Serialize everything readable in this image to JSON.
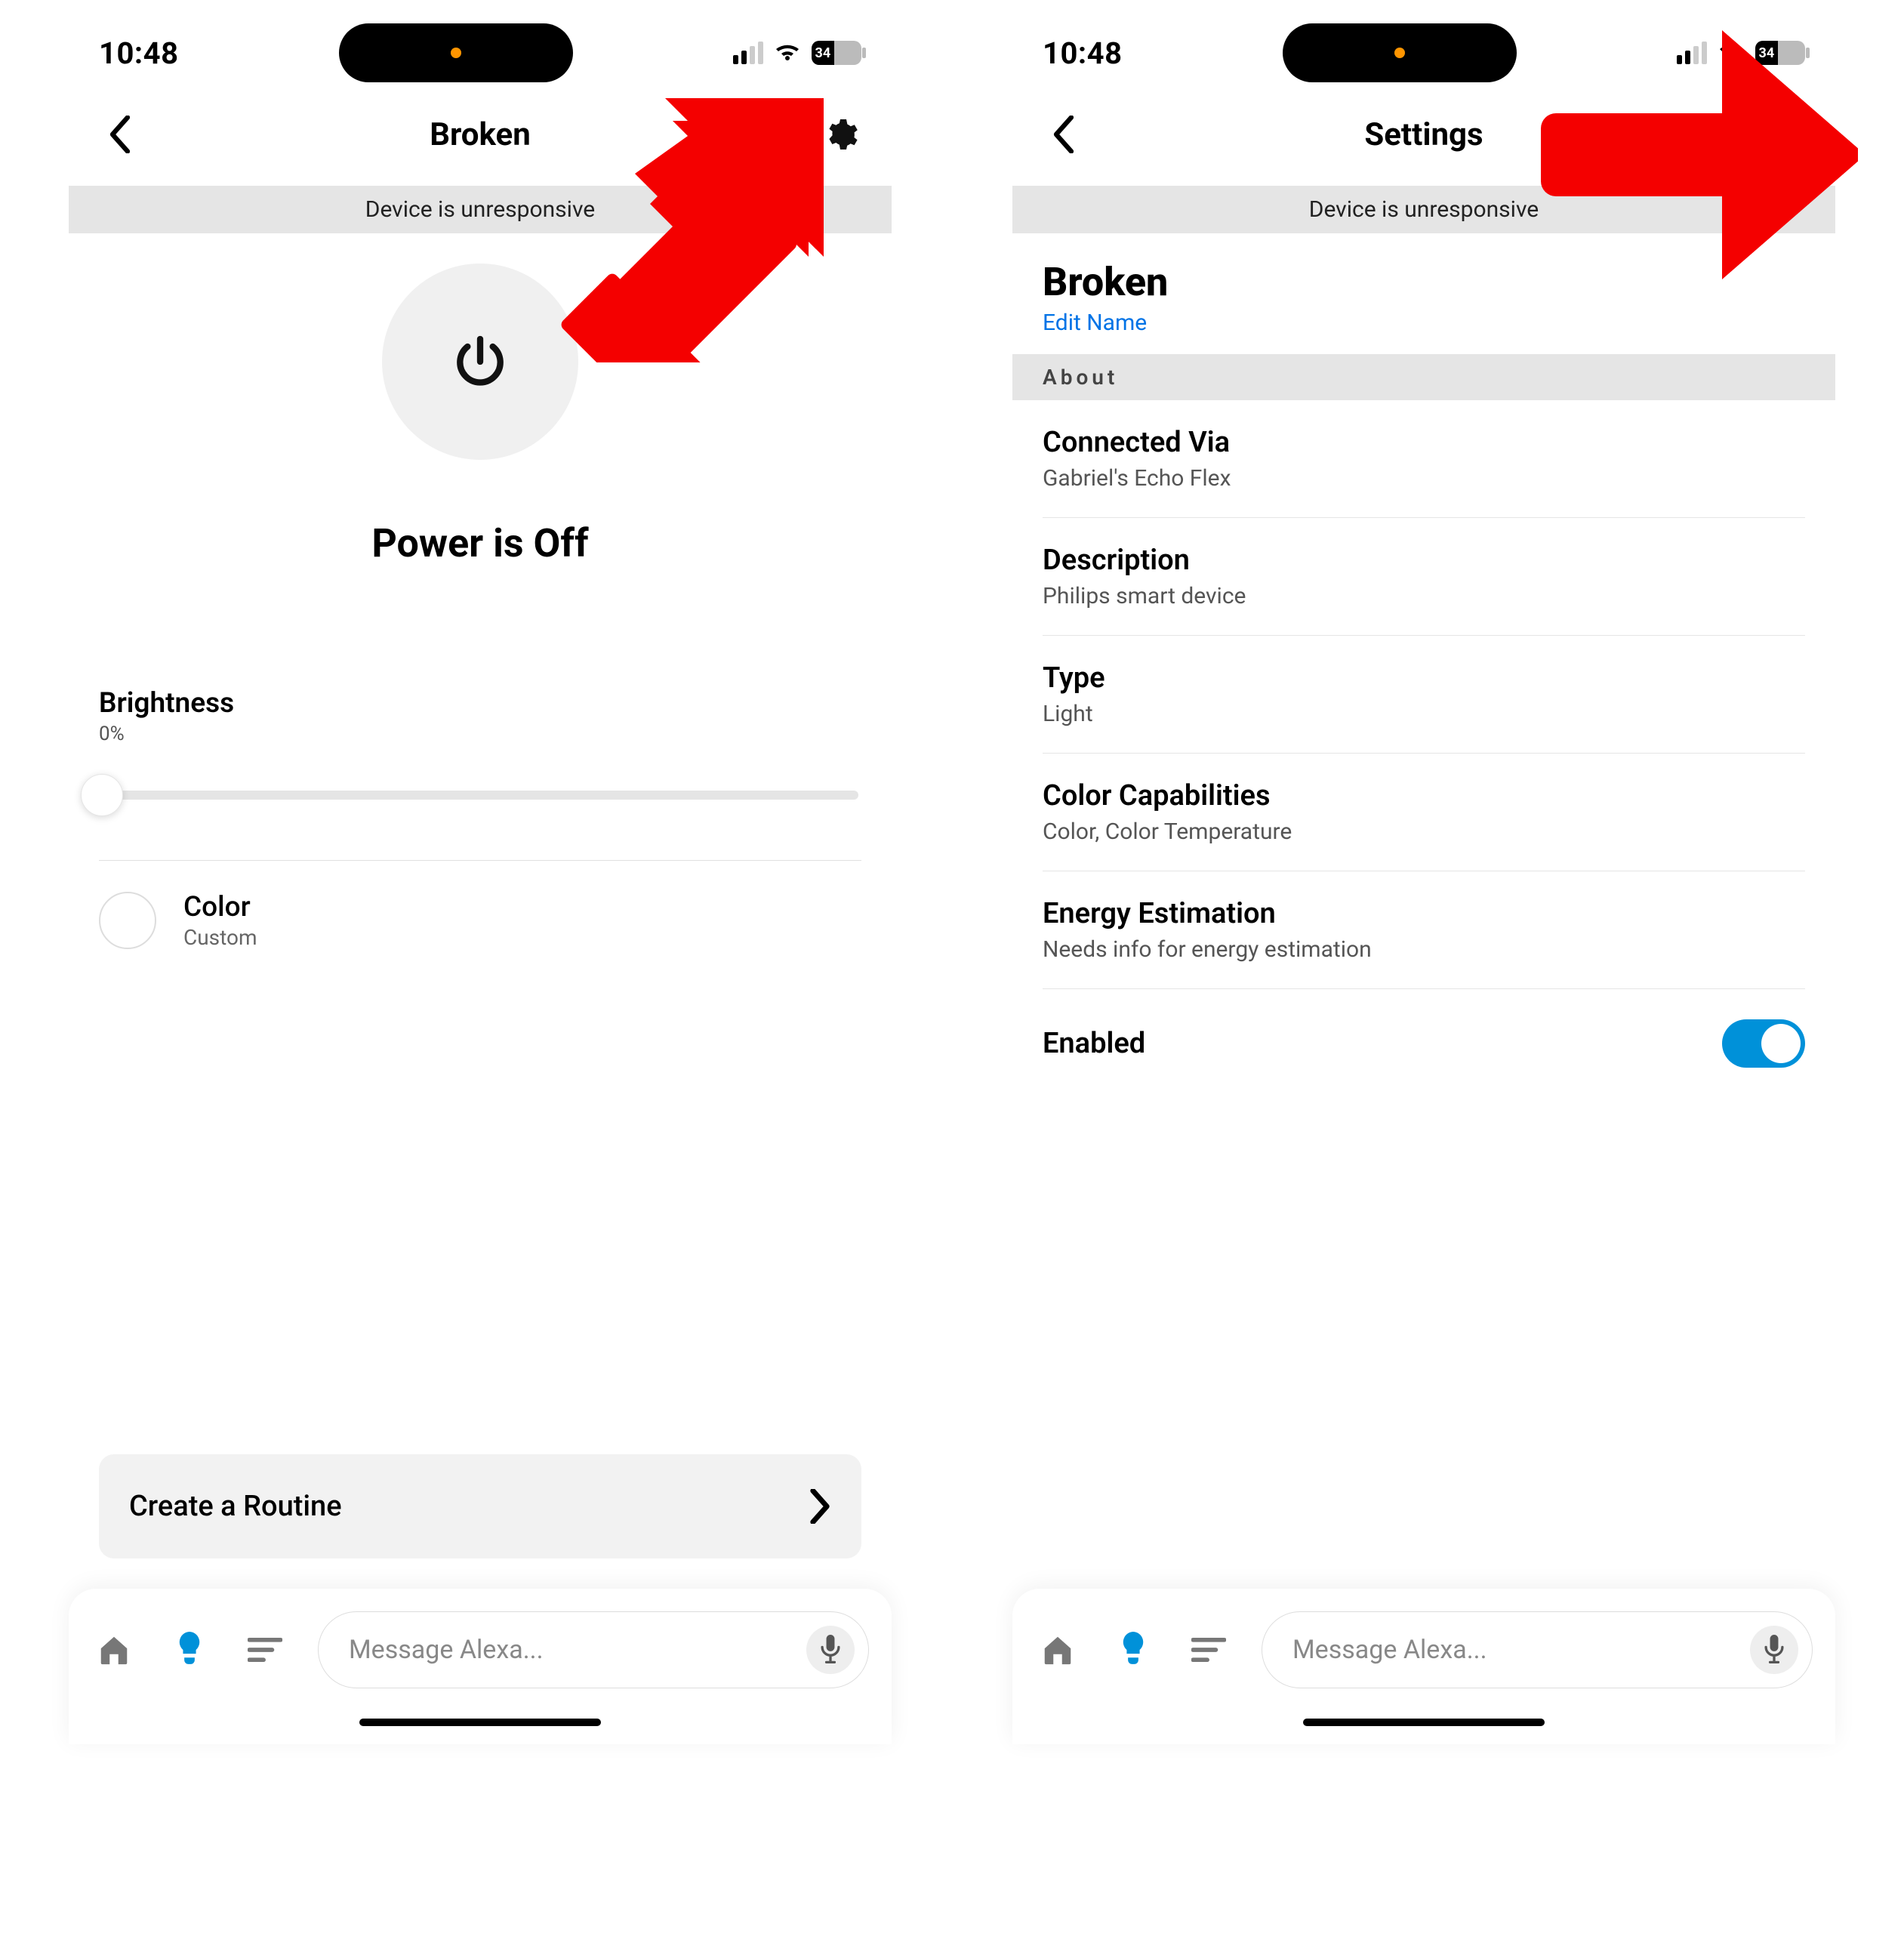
{
  "status": {
    "time": "10:48",
    "battery": "34"
  },
  "left": {
    "title": "Broken",
    "banner": "Device is unresponsive",
    "powerState": "Power is Off",
    "brightnessLabel": "Brightness",
    "brightnessValue": "0%",
    "colorLabel": "Color",
    "colorValue": "Custom",
    "routineLabel": "Create a Routine",
    "alexaPlaceholder": "Message Alexa..."
  },
  "right": {
    "title": "Settings",
    "banner": "Device is unresponsive",
    "deviceName": "Broken",
    "editName": "Edit Name",
    "sectionAbout": "About",
    "rows": {
      "connectedVia": {
        "title": "Connected Via",
        "sub": "Gabriel's Echo Flex"
      },
      "description": {
        "title": "Description",
        "sub": "Philips smart device"
      },
      "type": {
        "title": "Type",
        "sub": "Light"
      },
      "colorCap": {
        "title": "Color Capabilities",
        "sub": "Color, Color Temperature"
      },
      "energy": {
        "title": "Energy Estimation",
        "sub": "Needs info for energy estimation"
      }
    },
    "enabledLabel": "Enabled",
    "alexaPlaceholder": "Message Alexa..."
  }
}
